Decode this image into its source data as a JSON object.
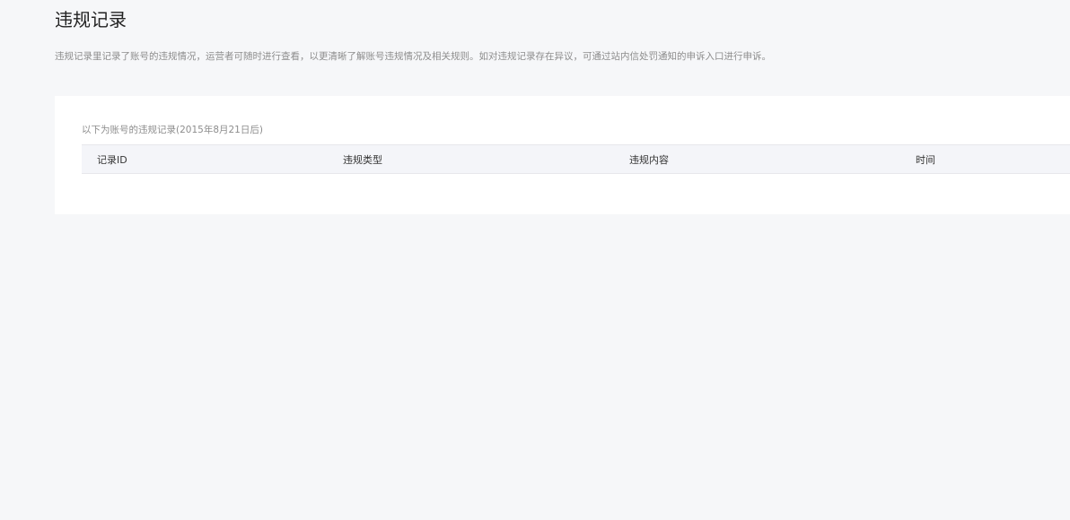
{
  "page": {
    "title": "违规记录",
    "description": "违规记录里记录了账号的违规情况，运营者可随时进行查看，以更清晰了解账号违规情况及相关规则。如对违规记录存在异议，可通过站内信处罚通知的申诉入口进行申诉。"
  },
  "records": {
    "caption": "以下为账号的违规记录(2015年8月21日后)",
    "columns": [
      "记录ID",
      "违规类型",
      "违规内容",
      "时间"
    ],
    "rows": []
  },
  "colors": {
    "page_background": "#f6f7f9",
    "card_background": "#ffffff",
    "table_header_background": "#f4f5f9",
    "muted_text": "#8d8d8d"
  }
}
